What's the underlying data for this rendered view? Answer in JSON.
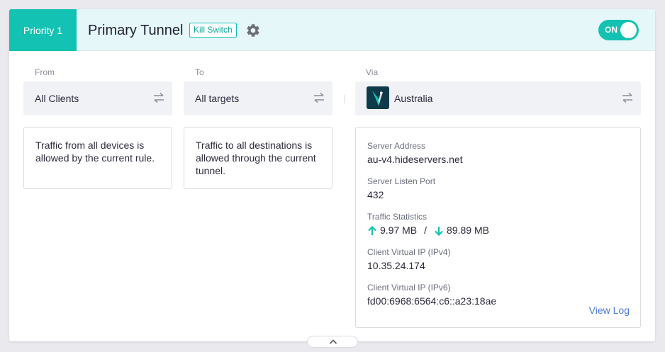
{
  "header": {
    "priority_label": "Priority 1",
    "title": "Primary Tunnel",
    "badge": "Kill Switch",
    "settings_icon": "gear-icon",
    "toggle_label": "ON",
    "toggle_on": true
  },
  "from": {
    "label": "From",
    "value": "All Clients",
    "description": "Traffic from all devices is allowed by the current rule."
  },
  "to": {
    "label": "To",
    "value": "All targets",
    "description": "Traffic to all destinations is allowed through the current tunnel."
  },
  "via": {
    "label": "Via",
    "value": "Australia",
    "icon": "vpn-logo-icon"
  },
  "details": {
    "server_address_label": "Server Address",
    "server_address": "au-v4.hideservers.net",
    "listen_port_label": "Server Listen Port",
    "listen_port": "432",
    "traffic_label": "Traffic Statistics",
    "upload": "9.97 MB",
    "download": "89.89 MB",
    "traffic_separator": "/",
    "ipv4_label": "Client Virtual IP (IPv4)",
    "ipv4": "10.35.24.174",
    "ipv6_label": "Client Virtual IP (IPv6)",
    "ipv6": "fd00:6968:6564:c6::a23:18ae",
    "view_log": "View Log"
  },
  "colors": {
    "accent": "#13c2b2",
    "header_bg": "#e5f7f8",
    "link": "#4a7bd6"
  }
}
